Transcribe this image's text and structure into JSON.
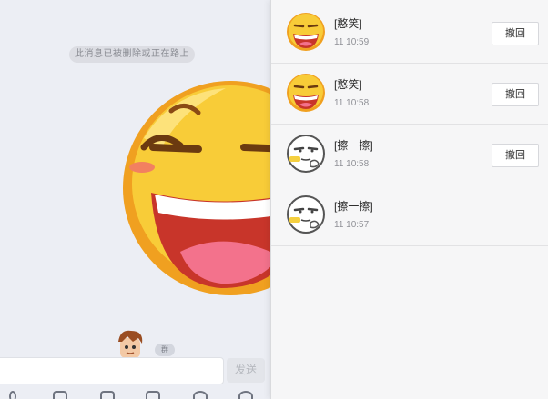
{
  "chat": {
    "system_notice": "此消息已被删除或正在路上",
    "nick_badge": "群",
    "input_placeholder": "",
    "send_label": "发送",
    "main_emoji": "laugh-emoji"
  },
  "recall_panel": {
    "items": [
      {
        "title": "[憨笑]",
        "time": "11 10:59",
        "button": "撤回",
        "emoji": "laugh-emoji"
      },
      {
        "title": "[憨笑]",
        "time": "11 10:58",
        "button": "撤回",
        "emoji": "laugh-emoji"
      },
      {
        "title": "[擦一擦]",
        "time": "11 10:58",
        "button": "撤回",
        "emoji": "wipe-sweat-emoji"
      },
      {
        "title": "[擦一擦]",
        "time": "11 10:57",
        "button": "",
        "emoji": "wipe-sweat-emoji"
      }
    ]
  },
  "colors": {
    "emoji_yellow": "#f7c32e",
    "emoji_orange": "#f0a020",
    "mouth_red": "#cc3b2a",
    "tongue_pink": "#f0708a"
  }
}
